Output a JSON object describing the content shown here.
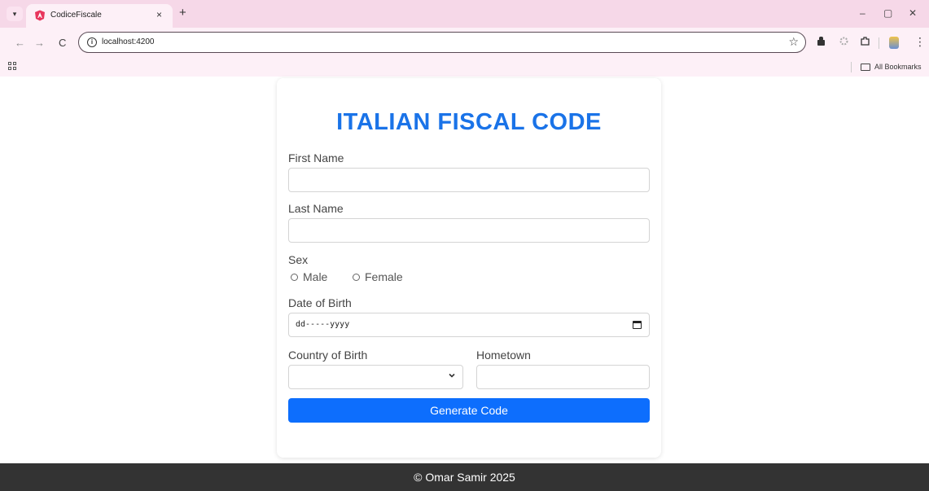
{
  "browser": {
    "tab_title": "CodiceFiscale",
    "tab_close": "×",
    "new_tab": "+",
    "url": "localhost:4200",
    "bookmarks_label": "All Bookmarks",
    "icons": {
      "back": "←",
      "forward": "→",
      "reload": "C",
      "star": "☆",
      "minimize": "–",
      "restore": "▢",
      "close": "✕",
      "kebab": "⋮",
      "tab_menu": "▾"
    }
  },
  "form": {
    "title": "ITALIAN FISCAL CODE",
    "first_name_label": "First Name",
    "first_name_value": "",
    "last_name_label": "Last Name",
    "last_name_value": "",
    "sex_label": "Sex",
    "sex_options": [
      "Male",
      "Female"
    ],
    "dob_label": "Date of Birth",
    "dob_placeholder": "dd-----yyyy",
    "country_label": "Country of Birth",
    "country_value": "",
    "hometown_label": "Hometown",
    "hometown_value": "",
    "submit_label": "Generate Code",
    "accent_color": "#1a73e8",
    "button_color": "#0d6efd"
  },
  "footer": {
    "text": "© Omar Samir 2025"
  }
}
